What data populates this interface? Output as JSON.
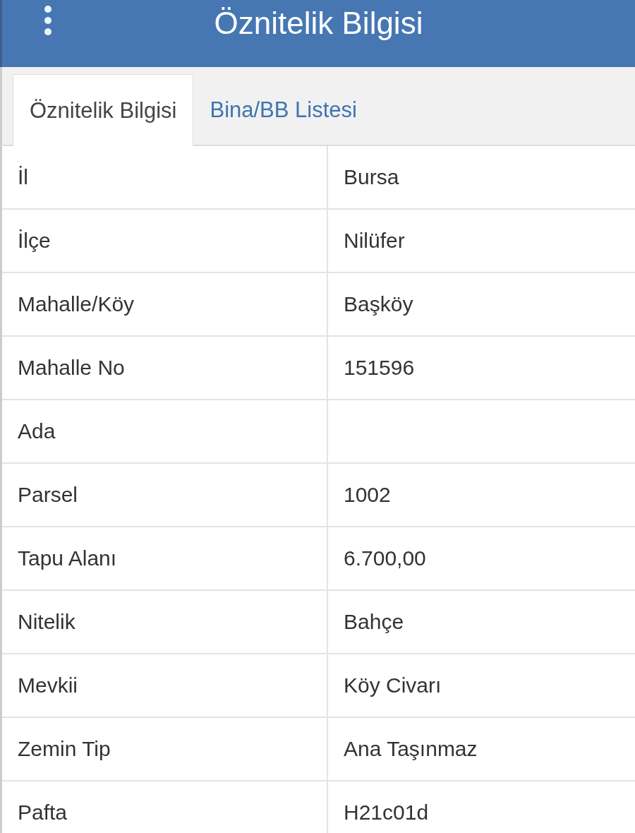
{
  "header": {
    "title": "Öznitelik Bilgisi"
  },
  "tabs": [
    {
      "label": "Öznitelik Bilgisi",
      "selected": true
    },
    {
      "label": "Bina/BB Listesi",
      "selected": false
    }
  ],
  "attributes": [
    {
      "label": "İl",
      "value": "Bursa"
    },
    {
      "label": "İlçe",
      "value": "Nilüfer"
    },
    {
      "label": "Mahalle/Köy",
      "value": "Başköy"
    },
    {
      "label": "Mahalle No",
      "value": "151596"
    },
    {
      "label": "Ada"
    },
    {
      "label": "Parsel",
      "value": "1002"
    },
    {
      "label": "Tapu Alanı",
      "value": "6.700,00"
    },
    {
      "label": "Nitelik",
      "value": "Bahçe"
    },
    {
      "label": "Mevkii",
      "value": "Köy Civarı"
    },
    {
      "label": "Zemin Tip",
      "value": "Ana Taşınmaz"
    },
    {
      "label": "Pafta",
      "value": "H21c01d"
    }
  ]
}
